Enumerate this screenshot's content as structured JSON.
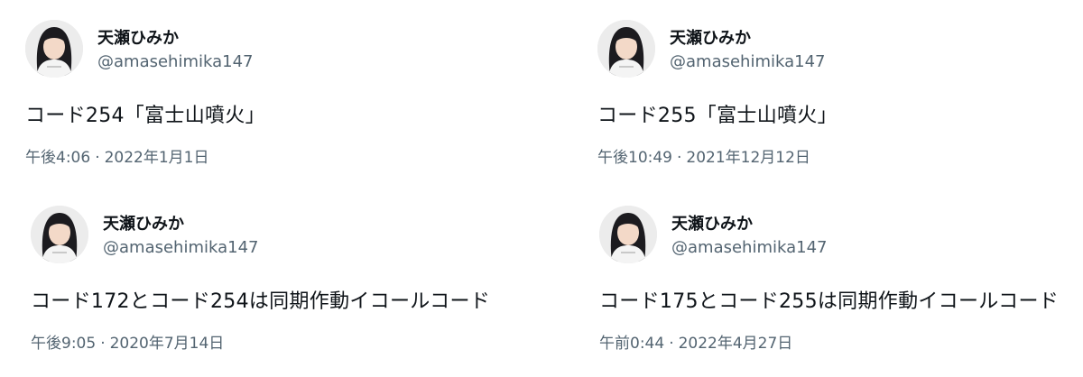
{
  "tweets": [
    {
      "name": "天瀬ひみか",
      "handle": "@amasehimika147",
      "text": "コード254「富士山噴火」",
      "time": "午後4:06",
      "date": "2022年1月1日"
    },
    {
      "name": "天瀬ひみか",
      "handle": "@amasehimika147",
      "text": "コード255「富士山噴火」",
      "time": "午後10:49",
      "date": "2021年12月12日"
    },
    {
      "name": "天瀬ひみか",
      "handle": "@amasehimika147",
      "text": "コード172とコード254は同期作動イコールコード",
      "time": "午後9:05",
      "date": "2020年7月14日"
    },
    {
      "name": "天瀬ひみか",
      "handle": "@amasehimika147",
      "text": "コード175とコード255は同期作動イコールコード",
      "time": "午前0:44",
      "date": "2022年4月27日"
    }
  ],
  "separator": "·"
}
